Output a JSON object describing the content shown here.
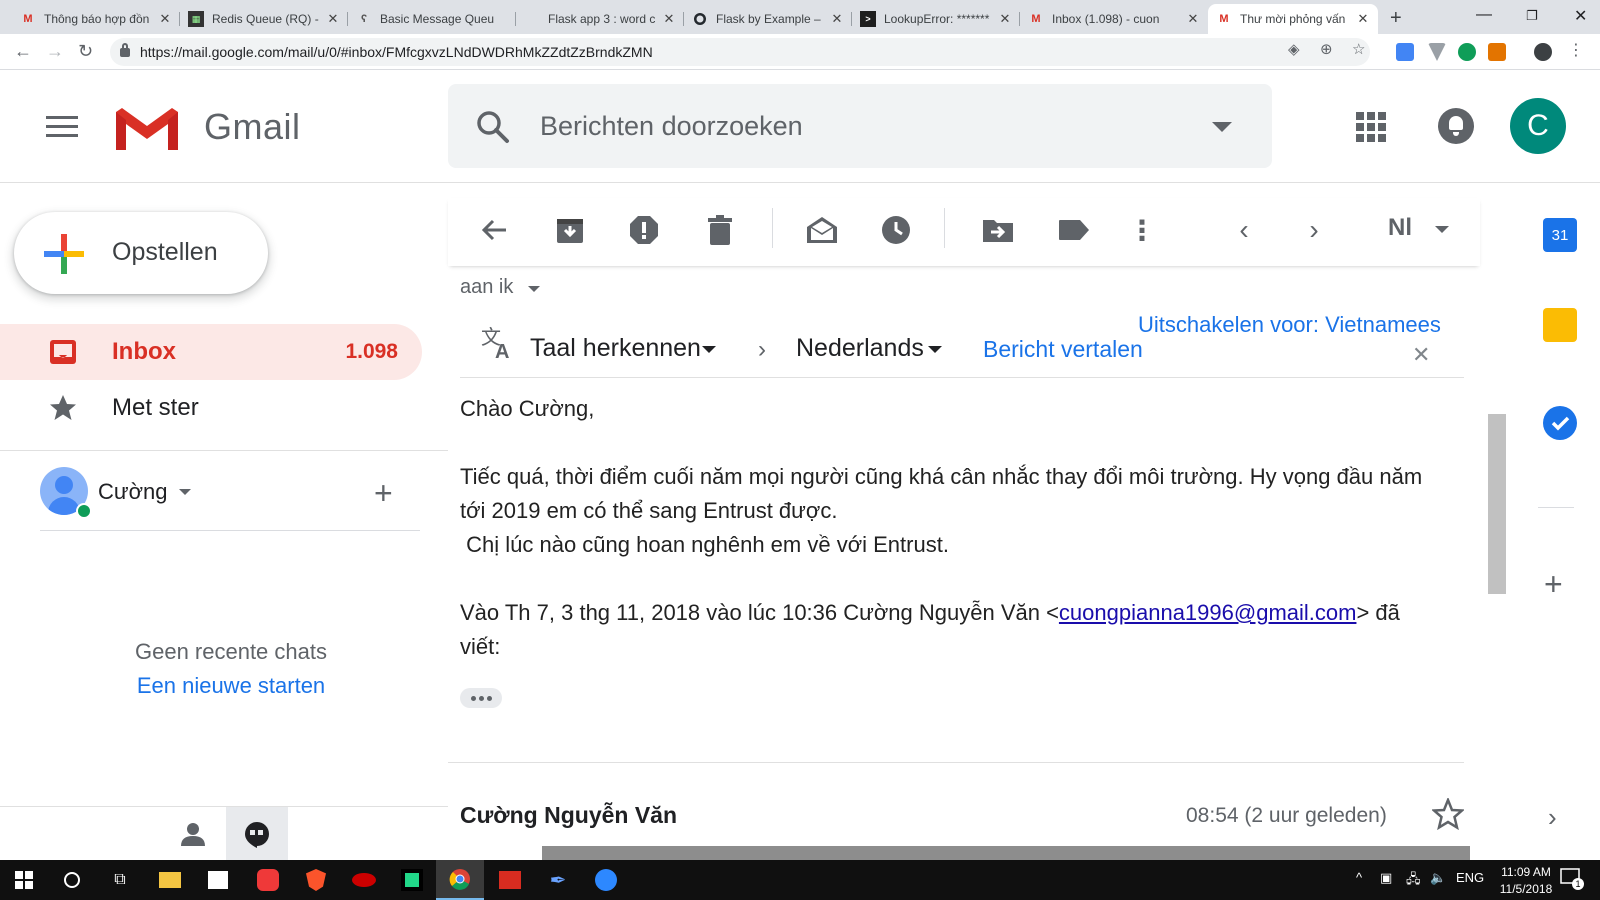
{
  "browser": {
    "tabs": [
      {
        "title": "Thông báo hợp đồn",
        "icon": "gmail-icon",
        "active": false
      },
      {
        "title": "Redis Queue (RQ) -",
        "icon": "redis-queue-icon",
        "active": false
      },
      {
        "title": "Basic Message Queu",
        "icon": "rabbit-icon",
        "active": false
      },
      {
        "title": "Flask app 3 : word c",
        "icon": "blank-page-icon",
        "active": false
      },
      {
        "title": "Flask by Example – ",
        "icon": "github-icon",
        "active": false
      },
      {
        "title": "LookupError: *******",
        "icon": "terminal-icon",
        "active": false
      },
      {
        "title": "Inbox (1.098) - cuon",
        "icon": "gmail-icon",
        "active": false
      },
      {
        "title": "Thư mời phỏng vấn",
        "icon": "gmail-icon",
        "active": true
      }
    ],
    "url": "https://mail.google.com/mail/u/0/#inbox/FMfcgxvzLNdDWDRhMkZZdtZzBrndkZMN"
  },
  "gmail": {
    "product_name": "Gmail",
    "search_placeholder": "Berichten doorzoeken",
    "account_initial": "C",
    "avatar_color": "#00897b",
    "compose_label": "Opstellen",
    "nav": [
      {
        "label": "Inbox",
        "count": "1.098",
        "icon": "inbox-icon",
        "active": true
      },
      {
        "label": "Met ster",
        "count": "",
        "icon": "star-icon",
        "active": false
      }
    ],
    "hangouts": {
      "user_name": "Cường",
      "no_chats": "Geen recente chats",
      "start_new": "Een nieuwe starten"
    }
  },
  "toolbar": {
    "page_lang": "Nl"
  },
  "message": {
    "recipient": "aan ik",
    "translate": {
      "detect_label": "Taal herkennen",
      "target_lang": "Nederlands",
      "translate_link": "Bericht vertalen",
      "disable_link": "Uitschakelen voor: Vietnamees"
    },
    "greeting": "Chào Cường,",
    "paragraph1_line1": "Tiếc quá, thời điểm cuối năm mọi người cũng khá cân nhắc thay đổi môi trường. Hy vọng đầu năm",
    "paragraph1_line2": "tới 2019 em có thể sang Entrust được.",
    "paragraph1_line3": " Chị lúc nào cũng hoan nghênh em về với Entrust.",
    "quote_prefix": "Vào Th 7, 3 thg 11, 2018 vào lúc 10:36 Cường Nguyễn Văn <",
    "quote_email": "cuongpianna1996@gmail.com",
    "quote_suffix": "> đã",
    "quote_line2": "viết:"
  },
  "next_message": {
    "sender": "Cường Nguyễn Văn",
    "time": "08:54 (2 uur geleden)"
  },
  "taskbar": {
    "lang": "ENG",
    "time": "11:09 AM",
    "date": "11/5/2018",
    "notification_count": "1"
  },
  "colors": {
    "gmail_red": "#d93025",
    "link_blue": "#1a73e8",
    "inbox_active_bg": "#fce8e6"
  }
}
